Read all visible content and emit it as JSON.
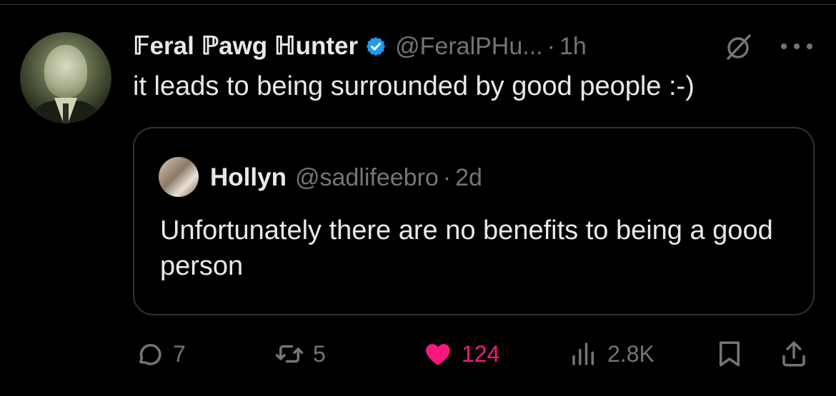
{
  "tweet": {
    "author_name": "𝔽eral ℙawg ℍunter",
    "handle": "@FeralPHu...",
    "separator": "·",
    "time": "1h",
    "text": "it leads to being surrounded by good people :-)"
  },
  "quote": {
    "author_name": "Hollyn",
    "handle": "@sadlifeebro",
    "separator": "·",
    "time": "2d",
    "text": "Unfortunately there are no benefits to being a good person"
  },
  "actions": {
    "replies": "7",
    "reposts": "5",
    "likes": "124",
    "views": "2.8K"
  },
  "colors": {
    "background": "#000000",
    "text": "#e7e9ea",
    "muted": "#71767b",
    "verified": "#1d9bf0",
    "like": "#f91880",
    "border": "#2f3336"
  },
  "icons": [
    "verified-badge-icon",
    "grok-icon",
    "more-icon",
    "reply-icon",
    "repost-icon",
    "heart-icon",
    "views-icon",
    "bookmark-icon",
    "share-icon"
  ]
}
